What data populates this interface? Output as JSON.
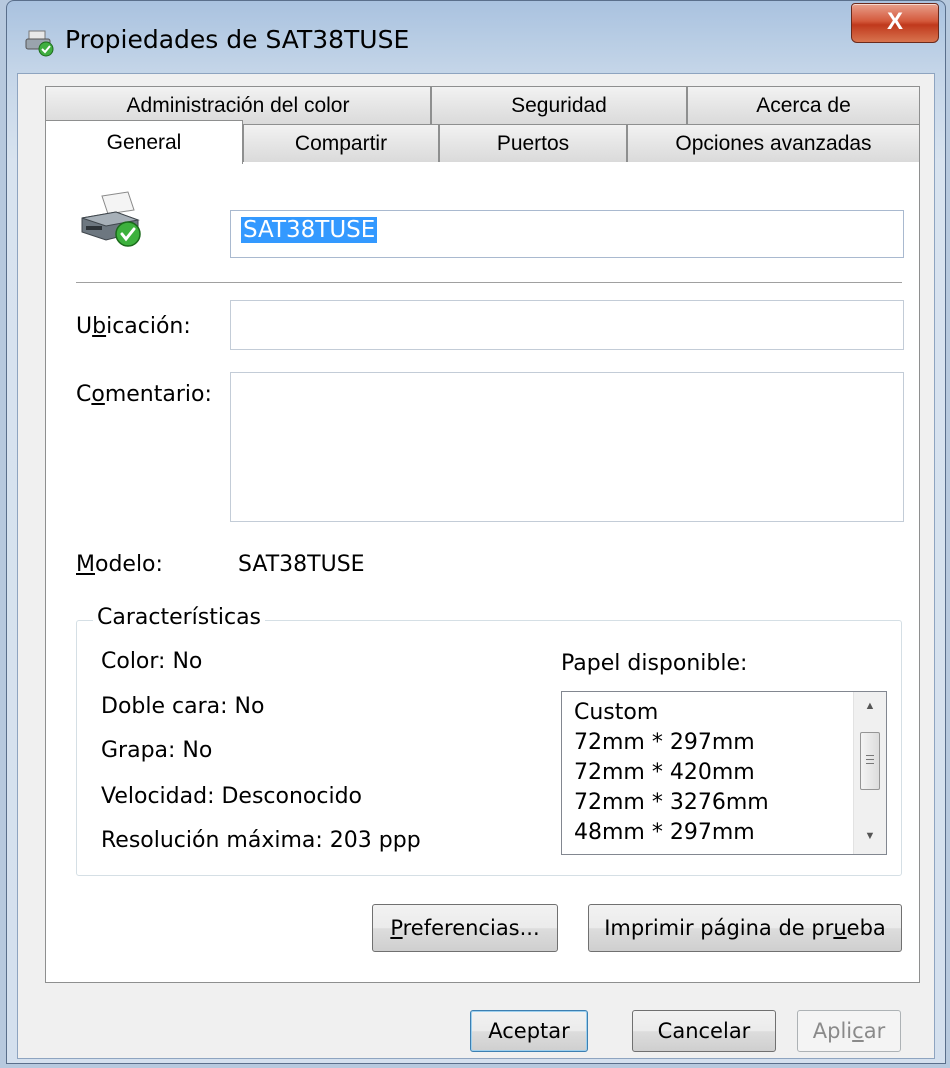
{
  "window": {
    "title": "Propiedades de SAT38TUSE",
    "close_glyph": "X"
  },
  "tabs": {
    "row_back": [
      "Administración del color",
      "Seguridad",
      "Acerca de"
    ],
    "row_front": [
      "General",
      "Compartir",
      "Puertos",
      "Opciones avanzadas"
    ],
    "active": "General"
  },
  "general": {
    "printer_name": "SAT38TUSE",
    "location_label_pre": "U",
    "location_label_access": "b",
    "location_label_post": "icación:",
    "location_value": "",
    "comment_label_pre": "C",
    "comment_label_access": "o",
    "comment_label_post": "mentario:",
    "comment_value": "",
    "model_label_access": "M",
    "model_label_post": "odelo:",
    "model_value": "SAT38TUSE"
  },
  "features": {
    "title": "Características",
    "color": "Color: No",
    "duplex": "Doble cara: No",
    "staple": "Grapa: No",
    "speed": "Velocidad: Desconocido",
    "resolution": "Resolución máxima: 203 ppp",
    "paper_label": "Papel disponible:",
    "paper_list": [
      "Custom",
      "72mm * 297mm",
      "72mm * 420mm",
      "72mm * 3276mm",
      "48mm * 297mm"
    ]
  },
  "buttons": {
    "preferences_access": "P",
    "preferences_post": "referencias...",
    "test_page_pre": "Imprimir página de pr",
    "test_page_access": "u",
    "test_page_post": "eba",
    "ok": "Aceptar",
    "cancel": "Cancelar",
    "apply_pre": "Apli",
    "apply_access": "c",
    "apply_post": "ar"
  },
  "colors": {
    "selection": "#3399ff",
    "close_button": "#c0391c",
    "title_bar": "#a9c2df"
  },
  "icons": {
    "title": "printer-check-icon",
    "printer": "printer-check-icon",
    "close": "close-icon"
  }
}
